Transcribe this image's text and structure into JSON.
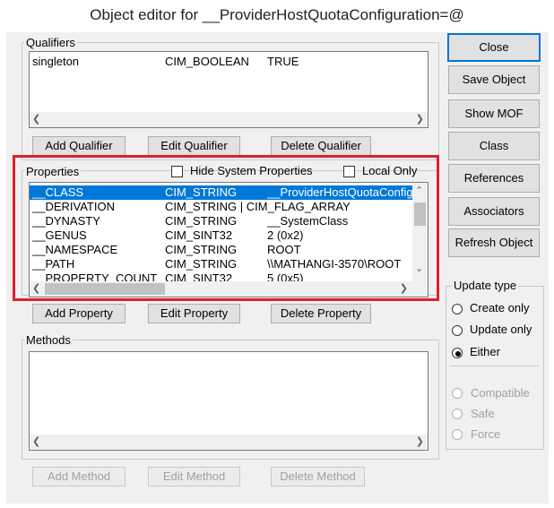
{
  "window": {
    "title": "Object editor for __ProviderHostQuotaConfiguration=@"
  },
  "qualifiers": {
    "label": "Qualifiers",
    "rows": [
      {
        "name": "singleton",
        "type": "CIM_BOOLEAN",
        "value": "TRUE"
      }
    ],
    "buttons": {
      "add": "Add Qualifier",
      "edit": "Edit Qualifier",
      "delete": "Delete Qualifier"
    }
  },
  "properties": {
    "label": "Properties",
    "hide_system_label": "Hide System Properties",
    "local_only_label": "Local Only",
    "hide_system_checked": false,
    "local_only_checked": false,
    "rows": [
      {
        "name": "__CLASS",
        "type": "CIM_STRING",
        "value": "__ProviderHostQuotaConfig",
        "selected": true
      },
      {
        "name": "__DERIVATION",
        "type": "CIM_STRING | CIM_FLAG_ARRAY",
        "value": "",
        "selected": false
      },
      {
        "name": "__DYNASTY",
        "type": "CIM_STRING",
        "value": "__SystemClass",
        "selected": false
      },
      {
        "name": "__GENUS",
        "type": "CIM_SINT32",
        "value": "2 (0x2)",
        "selected": false
      },
      {
        "name": "__NAMESPACE",
        "type": "CIM_STRING",
        "value": "ROOT",
        "selected": false
      },
      {
        "name": "__PATH",
        "type": "CIM_STRING",
        "value": "\\\\MATHANGI-3570\\ROOT",
        "selected": false
      },
      {
        "name": "__PROPERTY_COUNT",
        "type": "CIM_SINT32",
        "value": "5 (0x5)",
        "selected": false
      }
    ],
    "buttons": {
      "add": "Add Property",
      "edit": "Edit Property",
      "delete": "Delete Property"
    }
  },
  "methods": {
    "label": "Methods",
    "rows": [],
    "buttons": {
      "add": "Add Method",
      "edit": "Edit Method",
      "delete": "Delete Method"
    }
  },
  "side_buttons": {
    "close": "Close",
    "save": "Save Object",
    "show_mof": "Show MOF",
    "class": "Class",
    "references": "References",
    "associators": "Associators",
    "refresh": "Refresh Object"
  },
  "update_type": {
    "label": "Update type",
    "options": [
      {
        "label": "Create only",
        "selected": false,
        "enabled": true
      },
      {
        "label": "Update only",
        "selected": false,
        "enabled": true
      },
      {
        "label": "Either",
        "selected": true,
        "enabled": true
      }
    ],
    "secondary_options": [
      {
        "label": "Compatible",
        "selected": false,
        "enabled": false
      },
      {
        "label": "Safe",
        "selected": false,
        "enabled": false
      },
      {
        "label": "Force",
        "selected": false,
        "enabled": false
      }
    ]
  },
  "highlight_color": "#e0202a",
  "selection_color": "#0078d7"
}
